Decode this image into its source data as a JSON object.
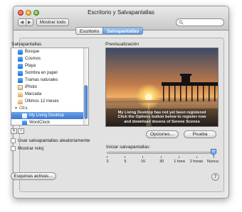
{
  "window": {
    "title": "Escritorio y Salvapantallas"
  },
  "toolbar": {
    "back_label": "◀",
    "forward_label": "▶",
    "show_all_label": "Mostrar todo",
    "search_placeholder": ""
  },
  "tabs": [
    {
      "label": "Escritorio",
      "active": false
    },
    {
      "label": "Salvapantallas",
      "active": true
    }
  ],
  "screensaver_list": {
    "title": "Salvapantallas",
    "items": [
      {
        "label": "Bosque",
        "icon": "screensaver-icon",
        "kind": "item",
        "selected": false
      },
      {
        "label": "Cosmos",
        "icon": "screensaver-icon",
        "kind": "item",
        "selected": false
      },
      {
        "label": "Playa",
        "icon": "screensaver-icon",
        "kind": "item",
        "selected": false
      },
      {
        "label": "Sombra en papel",
        "icon": "screensaver-icon",
        "kind": "item",
        "selected": false
      },
      {
        "label": "Tramas naturales",
        "icon": "screensaver-icon",
        "kind": "item",
        "selected": false
      },
      {
        "label": "iPhoto",
        "icon": "photo-icon",
        "kind": "item",
        "selected": false
      },
      {
        "label": "Marcada",
        "icon": "folder-icon",
        "kind": "item",
        "selected": false
      },
      {
        "label": "Últimos 12 meses",
        "icon": "folder-icon",
        "kind": "item",
        "selected": false
      },
      {
        "label": "Otra",
        "icon": "",
        "kind": "group",
        "selected": false
      },
      {
        "label": "My Living Desktop",
        "icon": "screensaver-icon",
        "kind": "item",
        "selected": true
      },
      {
        "label": "WordClock",
        "icon": "screensaver-icon",
        "kind": "item",
        "selected": false
      }
    ],
    "add_label": "+",
    "remove_label": "−"
  },
  "options": {
    "random_label": "Usar salvapantallas aleatoriamente",
    "random_checked": false,
    "clock_label": "Mostrar reloj",
    "clock_checked": false
  },
  "preview": {
    "title": "Previsualización",
    "message_line1": "My Living Desktop has not yet been registered",
    "message_line2": "Click the Options button below to register now",
    "message_line3": "and download dozens of Serene Scenes"
  },
  "buttons": {
    "options_label": "Opciones…",
    "test_label": "Prueba",
    "hot_corners_label": "Esquinas activas…",
    "help_label": "?"
  },
  "start_after": {
    "label": "Iniciar salvapantallas:",
    "ticks": [
      "3",
      "5",
      "15",
      "30",
      "1 hora",
      "2 horas",
      "Nunca"
    ],
    "selected": "Nunca"
  }
}
